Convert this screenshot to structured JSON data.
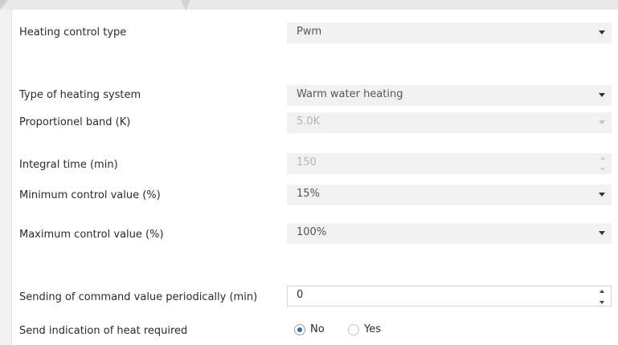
{
  "rows": {
    "heating_control_type": {
      "label": "Heating control type",
      "value": "Pwm"
    },
    "heating_system_type": {
      "label": "Type of heating system",
      "value": "Warm water heating"
    },
    "proportional_band": {
      "label": "Proportionel band (K)",
      "value": "5.0K"
    },
    "integral_time": {
      "label": "Integral time (min)",
      "value": "150"
    },
    "min_control_value": {
      "label": "Minimum control value (%)",
      "value": "15%"
    },
    "max_control_value": {
      "label": "Maximum control value (%)",
      "value": "100%"
    },
    "send_period": {
      "label": "Sending of command value periodically (min)",
      "value": "0"
    },
    "heat_required": {
      "label": "Send indication of heat required",
      "options": [
        "No",
        "Yes"
      ],
      "selected": "No"
    }
  },
  "icons": {
    "dropdown": "caret-down-icon",
    "spinner": "spinner-arrows-icon",
    "accent": "#2e6da4"
  }
}
